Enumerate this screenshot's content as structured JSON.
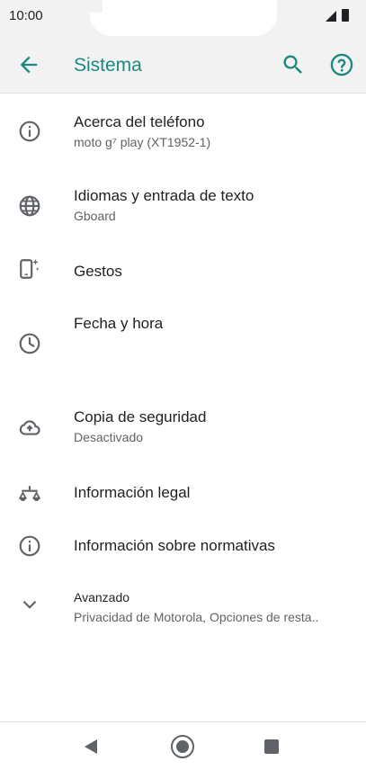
{
  "status": {
    "time": "10:00"
  },
  "appbar": {
    "title": "Sistema",
    "icons": [
      "back-arrow-icon",
      "search-icon",
      "help-icon"
    ]
  },
  "colors": {
    "accent": "#1a8a7f",
    "icon_gray": "#5f6368"
  },
  "items": [
    {
      "title": "Acerca del teléfono",
      "subtitle": "moto g⁷ play (XT1952-1)",
      "icon": "info-icon"
    },
    {
      "title": "Idiomas y entrada de texto",
      "subtitle": "Gboard",
      "icon": "globe-icon"
    },
    {
      "title": "Gestos",
      "subtitle": "",
      "icon": "gestures-phone-icon"
    },
    {
      "title": "Fecha y hora",
      "subtitle": "",
      "icon": "clock-icon"
    },
    {
      "title": "Copia de seguridad",
      "subtitle": "Desactivado",
      "icon": "cloud-backup-icon"
    },
    {
      "title": "Información legal",
      "subtitle": "",
      "icon": "scale-icon"
    },
    {
      "title": "Información sobre normativas",
      "subtitle": "",
      "icon": "info-icon"
    },
    {
      "title": "Avanzado",
      "subtitle": "Privacidad de Motorola, Opciones de resta..",
      "icon": "chevron-down-icon"
    }
  ],
  "navbar": {
    "icons": [
      "back-triangle-icon",
      "home-circle-icon",
      "recents-square-icon"
    ]
  }
}
